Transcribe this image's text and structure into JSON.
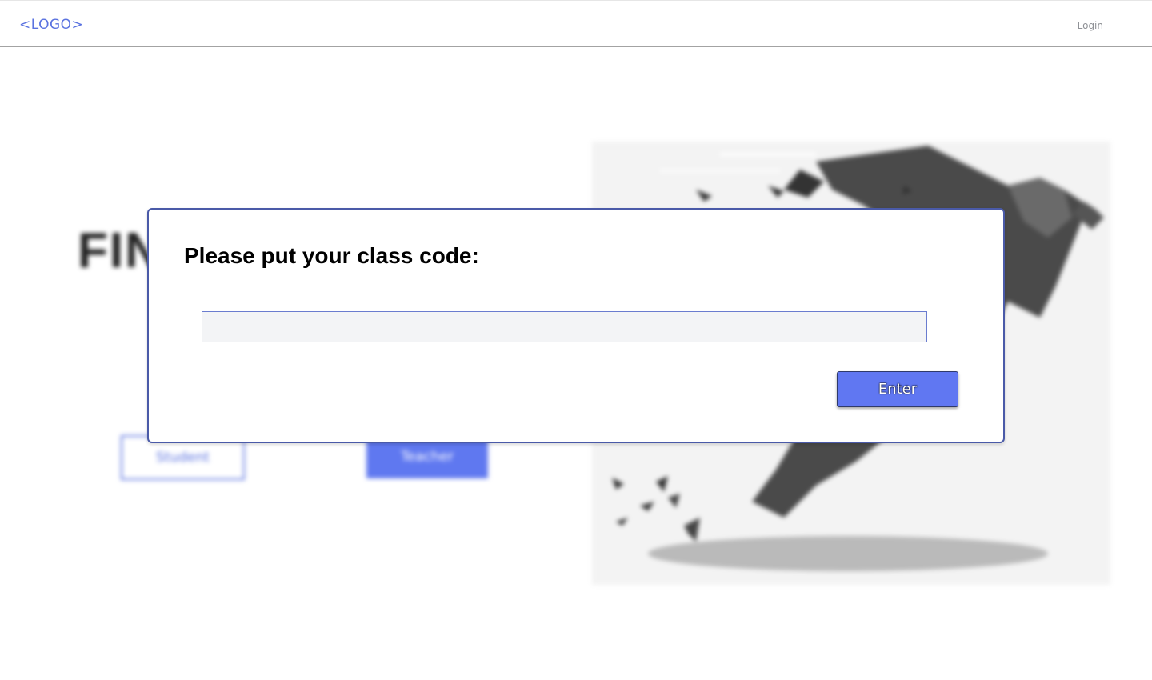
{
  "header": {
    "logo_text": "<LOGO>",
    "login_label": "Login"
  },
  "background": {
    "hero_title": "FIN",
    "student_label": "Student",
    "teacher_label": "Teacher"
  },
  "modal": {
    "title": "Please put your class code:",
    "input_value": "",
    "input_placeholder": "",
    "enter_label": "Enter"
  },
  "colors": {
    "accent": "#5f78f0",
    "modal_border": "#4a5aa8",
    "logo": "#5b73e0"
  }
}
